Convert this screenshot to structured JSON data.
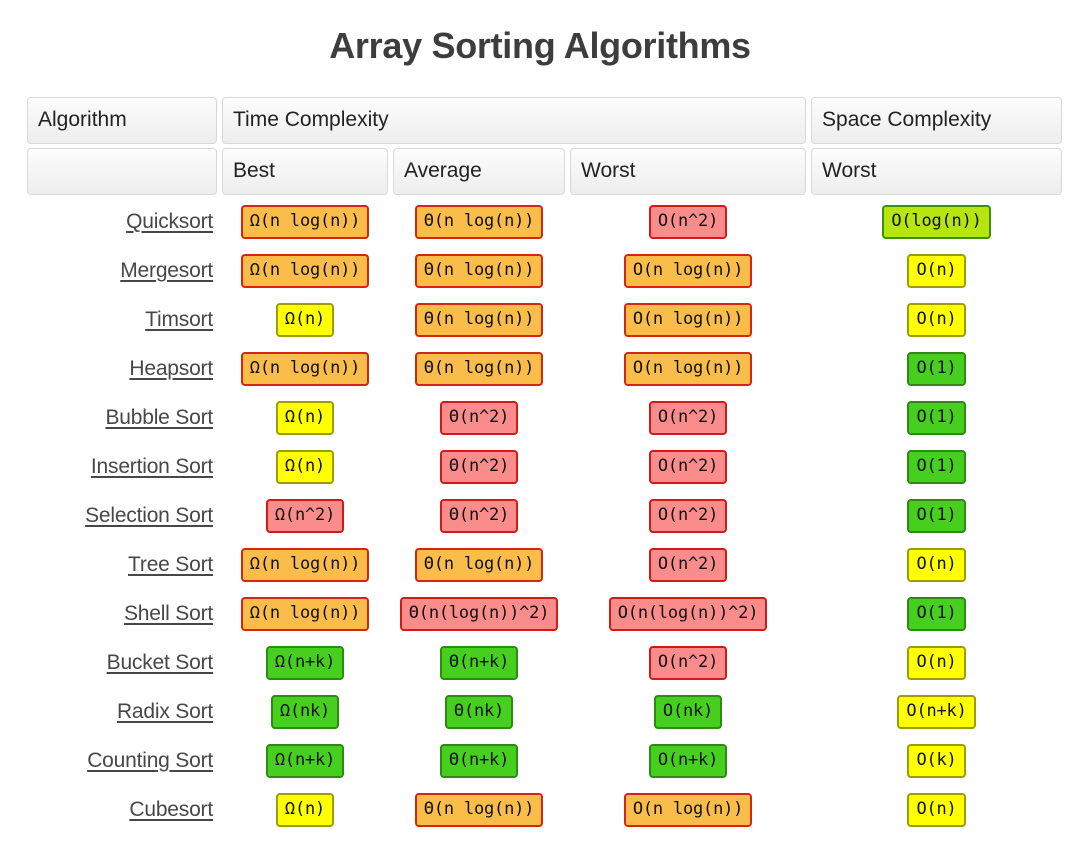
{
  "page": {
    "title": "Array Sorting Algorithms"
  },
  "table": {
    "header_top": {
      "algorithm": "Algorithm",
      "time_complexity": "Time Complexity",
      "space_complexity": "Space Complexity"
    },
    "header_sub": {
      "algorithm": "",
      "best": "Best",
      "average": "Average",
      "worst": "Worst",
      "space_worst": "Worst"
    },
    "rows": [
      {
        "algorithm": "Quicksort",
        "best": {
          "text": "Ω(n log(n))",
          "color": "orange"
        },
        "average": {
          "text": "Θ(n log(n))",
          "color": "orange"
        },
        "worst": {
          "text": "O(n^2)",
          "color": "red"
        },
        "space": {
          "text": "O(log(n))",
          "color": "lime"
        }
      },
      {
        "algorithm": "Mergesort",
        "best": {
          "text": "Ω(n log(n))",
          "color": "orange"
        },
        "average": {
          "text": "Θ(n log(n))",
          "color": "orange"
        },
        "worst": {
          "text": "O(n log(n))",
          "color": "orange"
        },
        "space": {
          "text": "O(n)",
          "color": "yellow"
        }
      },
      {
        "algorithm": "Timsort",
        "best": {
          "text": "Ω(n)",
          "color": "yellow"
        },
        "average": {
          "text": "Θ(n log(n))",
          "color": "orange"
        },
        "worst": {
          "text": "O(n log(n))",
          "color": "orange"
        },
        "space": {
          "text": "O(n)",
          "color": "yellow"
        }
      },
      {
        "algorithm": "Heapsort",
        "best": {
          "text": "Ω(n log(n))",
          "color": "orange"
        },
        "average": {
          "text": "Θ(n log(n))",
          "color": "orange"
        },
        "worst": {
          "text": "O(n log(n))",
          "color": "orange"
        },
        "space": {
          "text": "O(1)",
          "color": "green"
        }
      },
      {
        "algorithm": "Bubble Sort",
        "best": {
          "text": "Ω(n)",
          "color": "yellow"
        },
        "average": {
          "text": "Θ(n^2)",
          "color": "red"
        },
        "worst": {
          "text": "O(n^2)",
          "color": "red"
        },
        "space": {
          "text": "O(1)",
          "color": "green"
        }
      },
      {
        "algorithm": "Insertion Sort",
        "best": {
          "text": "Ω(n)",
          "color": "yellow"
        },
        "average": {
          "text": "Θ(n^2)",
          "color": "red"
        },
        "worst": {
          "text": "O(n^2)",
          "color": "red"
        },
        "space": {
          "text": "O(1)",
          "color": "green"
        }
      },
      {
        "algorithm": "Selection Sort",
        "best": {
          "text": "Ω(n^2)",
          "color": "red"
        },
        "average": {
          "text": "Θ(n^2)",
          "color": "red"
        },
        "worst": {
          "text": "O(n^2)",
          "color": "red"
        },
        "space": {
          "text": "O(1)",
          "color": "green"
        }
      },
      {
        "algorithm": "Tree Sort",
        "best": {
          "text": "Ω(n log(n))",
          "color": "orange"
        },
        "average": {
          "text": "Θ(n log(n))",
          "color": "orange"
        },
        "worst": {
          "text": "O(n^2)",
          "color": "red"
        },
        "space": {
          "text": "O(n)",
          "color": "yellow"
        }
      },
      {
        "algorithm": "Shell Sort",
        "best": {
          "text": "Ω(n log(n))",
          "color": "orange"
        },
        "average": {
          "text": "Θ(n(log(n))^2)",
          "color": "red"
        },
        "worst": {
          "text": "O(n(log(n))^2)",
          "color": "red"
        },
        "space": {
          "text": "O(1)",
          "color": "green"
        }
      },
      {
        "algorithm": "Bucket Sort",
        "best": {
          "text": "Ω(n+k)",
          "color": "green"
        },
        "average": {
          "text": "Θ(n+k)",
          "color": "green"
        },
        "worst": {
          "text": "O(n^2)",
          "color": "red"
        },
        "space": {
          "text": "O(n)",
          "color": "yellow"
        }
      },
      {
        "algorithm": "Radix Sort",
        "best": {
          "text": "Ω(nk)",
          "color": "green"
        },
        "average": {
          "text": "Θ(nk)",
          "color": "green"
        },
        "worst": {
          "text": "O(nk)",
          "color": "green"
        },
        "space": {
          "text": "O(n+k)",
          "color": "yellow"
        }
      },
      {
        "algorithm": "Counting Sort",
        "best": {
          "text": "Ω(n+k)",
          "color": "green"
        },
        "average": {
          "text": "Θ(n+k)",
          "color": "green"
        },
        "worst": {
          "text": "O(n+k)",
          "color": "green"
        },
        "space": {
          "text": "O(k)",
          "color": "yellow"
        }
      },
      {
        "algorithm": "Cubesort",
        "best": {
          "text": "Ω(n)",
          "color": "yellow"
        },
        "average": {
          "text": "Θ(n log(n))",
          "color": "orange"
        },
        "worst": {
          "text": "O(n log(n))",
          "color": "orange"
        },
        "space": {
          "text": "O(n)",
          "color": "yellow"
        }
      }
    ]
  },
  "colors": {
    "red_bg": "#fb8c8c",
    "red_border": "#d11b1b",
    "orange_bg": "#fbbd4a",
    "orange_border": "#d62512",
    "yellow_bg": "#ffff00",
    "yellow_border": "#9c9c07",
    "lime_bg": "#b7e510",
    "lime_border": "#3f8f0b",
    "green_bg": "#46cf1f",
    "green_border": "#2d8b12",
    "title": "#3d3d3d",
    "link": "#474747",
    "header_bg": "#f4f4f4"
  }
}
